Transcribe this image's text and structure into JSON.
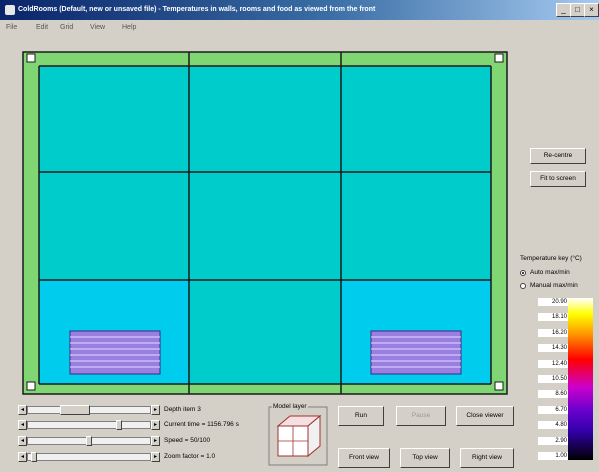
{
  "window": {
    "title": "ColdRooms (Default, new or unsaved file) - Temperatures in walls, rooms and food as viewed from the front",
    "min": "_",
    "max": "□",
    "close": "×"
  },
  "menu": [
    "File",
    "Edit",
    "Grid",
    "View",
    "Help"
  ],
  "buttons": {
    "recentre": "Re-centre",
    "fit_to_screen": "Fit to screen",
    "run": "Run",
    "pause": "Pause",
    "close_viewer": "Close viewer",
    "front_view": "Front view",
    "top_view": "Top view",
    "right_view": "Right view"
  },
  "key": {
    "title": "Temperature key (°C)",
    "auto_label": "Auto max/min",
    "manual_label": "Manual max/min",
    "auto_selected": true,
    "values": [
      "20.90",
      "18.10",
      "16.20",
      "14.30",
      "12.40",
      "10.50",
      "8.60",
      "6.70",
      "4.80",
      "2.90",
      "1.00"
    ]
  },
  "sliders": [
    {
      "label": "Depth item 3",
      "value_fraction": 0.35
    },
    {
      "label": "Current time = 1156.796 s",
      "value_fraction": 0.75
    },
    {
      "label": "Speed = 50/100",
      "value_fraction": 0.5
    },
    {
      "label": "Zoom factor = 1.0",
      "value_fraction": 0.03
    }
  ],
  "model_layer_label": "Model layer",
  "colors": {
    "wall_outer": "#7fd673",
    "room_upper": "#00cccc",
    "room_lower": "#00ccee",
    "food": "#9a7fe0",
    "grid_line": "#1a1a1a"
  }
}
